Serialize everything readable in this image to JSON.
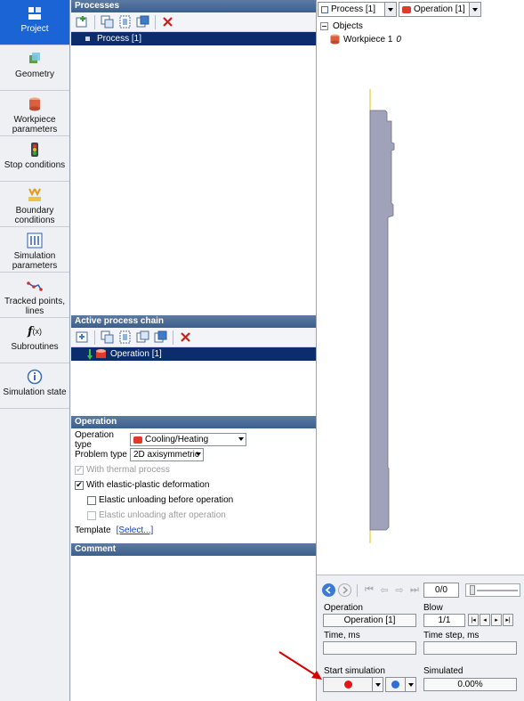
{
  "nav": [
    {
      "label": "Project",
      "icon": "project-icon",
      "active": true
    },
    {
      "label": "Geometry",
      "icon": "geometry-icon"
    },
    {
      "label": "Workpiece parameters",
      "icon": "workpiece-icon"
    },
    {
      "label": "Stop conditions",
      "icon": "traffic-light-icon"
    },
    {
      "label": "Boundary conditions",
      "icon": "boundary-icon"
    },
    {
      "label": "Simulation parameters",
      "icon": "sliders-icon"
    },
    {
      "label": "Tracked points, lines",
      "icon": "tracked-points-icon"
    },
    {
      "label": "Subroutines",
      "icon": "function-icon"
    },
    {
      "label": "Simulation state",
      "icon": "info-icon"
    }
  ],
  "processes": {
    "header": "Processes",
    "items": [
      "Process [1]"
    ]
  },
  "chain": {
    "header": "Active process chain",
    "items": [
      "Operation [1]"
    ]
  },
  "operation": {
    "header": "Operation",
    "op_type_label": "Operation type",
    "op_type_value": "Cooling/Heating",
    "problem_type_label": "Problem type",
    "problem_type_value": "2D axisymmetric",
    "with_thermal": "With thermal process",
    "with_elastic": "With elastic-plastic deformation",
    "elastic_before": "Elastic unloading before operation",
    "elastic_after": "Elastic unloading after operation",
    "template_label": "Template",
    "template_link": "[Select...]"
  },
  "comment": {
    "header": "Comment"
  },
  "right": {
    "process_combo": "Process [1]",
    "operation_combo": "Operation [1]",
    "tree_root": "Objects",
    "tree_item": "Workpiece 1",
    "tree_item_suffix": "0"
  },
  "playback": {
    "counter": "0/0"
  },
  "sim": {
    "operation_label": "Operation",
    "operation_value": "Operation [1]",
    "blow_label": "Blow",
    "blow_value": "1/1",
    "time_label": "Time, ms",
    "time_step_label": "Time step, ms",
    "start_label": "Start simulation",
    "simulated_label": "Simulated",
    "simulated_value": "0.00%"
  },
  "colors": {
    "accent": "#1b64d6",
    "header": "#3d5f8c",
    "selection": "#0c2d6b",
    "part_fill": "#9fa2b8",
    "record": "#e01818",
    "annotation": "#d40000"
  }
}
